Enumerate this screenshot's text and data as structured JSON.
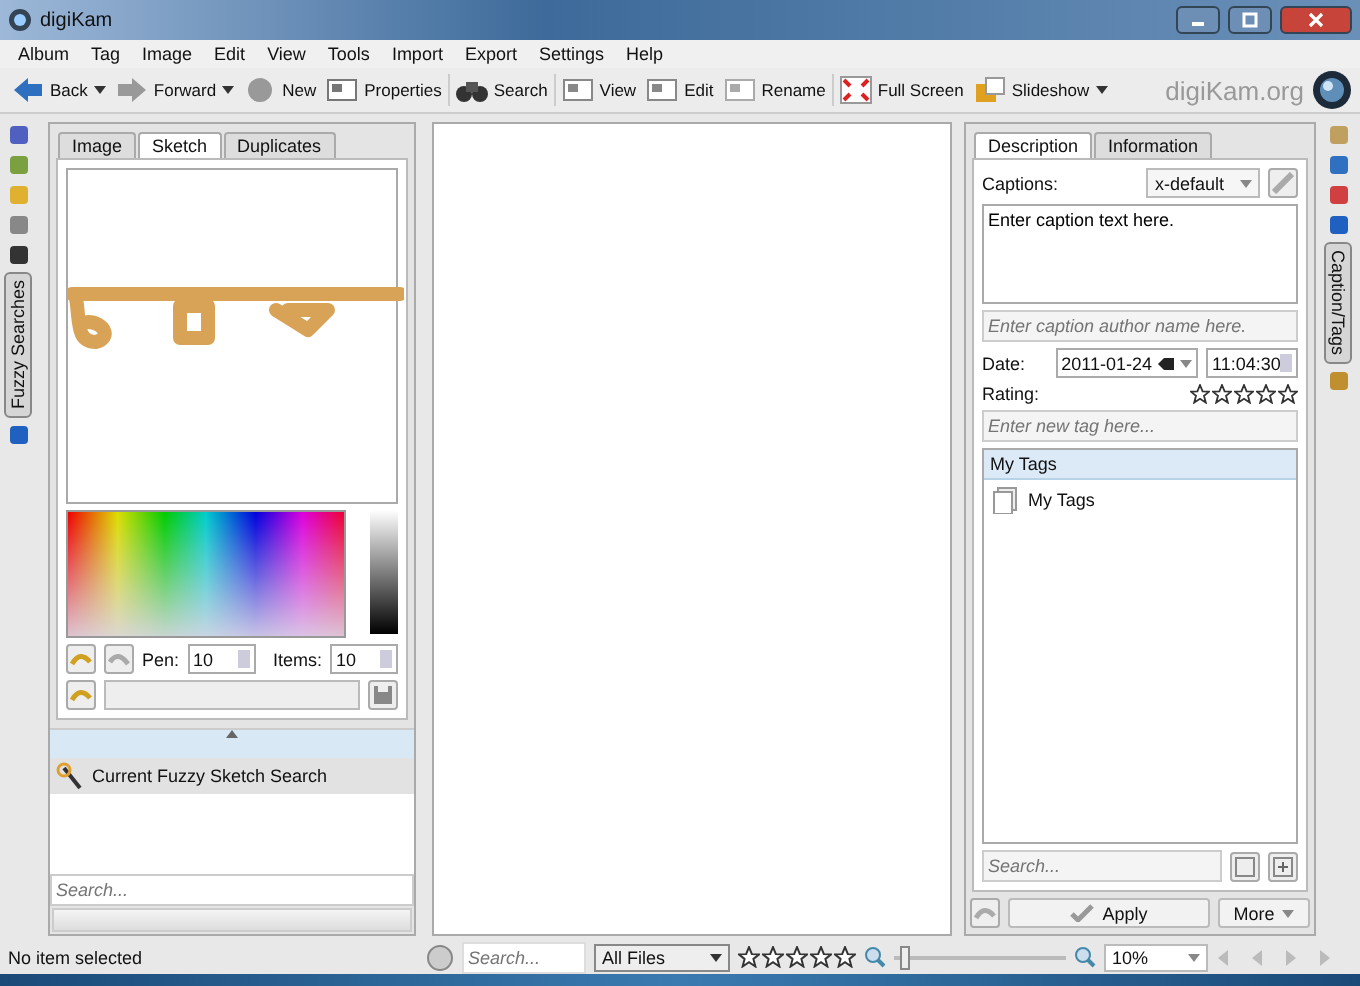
{
  "window": {
    "title": "digiKam"
  },
  "menu": [
    "Album",
    "Tag",
    "Image",
    "Edit",
    "View",
    "Tools",
    "Import",
    "Export",
    "Settings",
    "Help"
  ],
  "toolbar": [
    {
      "label": "Back",
      "kind": "back",
      "dropdown": true
    },
    {
      "label": "Forward",
      "kind": "forward",
      "dropdown": true
    },
    {
      "label": "New",
      "kind": "new",
      "dropdown": false
    },
    {
      "label": "Properties",
      "kind": "properties",
      "dropdown": false
    },
    {
      "label": "Search",
      "kind": "search",
      "dropdown": false
    },
    {
      "label": "View",
      "kind": "view",
      "dropdown": false
    },
    {
      "label": "Edit",
      "kind": "edit",
      "dropdown": false
    },
    {
      "label": "Rename",
      "kind": "rename",
      "dropdown": false
    },
    {
      "label": "Full Screen",
      "kind": "fullscreen",
      "dropdown": false
    },
    {
      "label": "Slideshow",
      "kind": "slideshow",
      "dropdown": true
    }
  ],
  "brand": "digiKam.org",
  "left_sidebar": [
    {
      "selected": false
    },
    {
      "selected": false
    },
    {
      "selected": false
    },
    {
      "selected": false
    },
    {
      "selected": false
    },
    {
      "label": "Fuzzy Searches",
      "selected": true
    },
    {
      "selected": false
    }
  ],
  "fuzzy_panel": {
    "tabs": [
      {
        "label": "Image",
        "selected": false
      },
      {
        "label": "Sketch",
        "selected": true
      },
      {
        "label": "Duplicates",
        "selected": false
      }
    ],
    "pen_label": "Pen:",
    "pen": "10",
    "items_label": "Items:",
    "items": "10",
    "saved_searches": {
      "items": [
        {
          "label": "Current Fuzzy Sketch Search",
          "selected": true
        }
      ]
    },
    "search": {
      "placeholder": "Search..."
    }
  },
  "right_panel": {
    "tabs": [
      {
        "label": "Description",
        "selected": true
      },
      {
        "label": "Information",
        "selected": false
      }
    ],
    "captions_label": "Captions:",
    "language": "x-default",
    "caption_text": "Enter caption text here.",
    "author": {
      "placeholder": "Enter caption author name here."
    },
    "date_label": "Date:",
    "date": "2011-01-24",
    "time": "11:04:30",
    "rating_label": "Rating:",
    "stars": 0,
    "new_tag": {
      "placeholder": "Enter new tag here..."
    },
    "tags": {
      "header": "My Tags",
      "children": [
        {
          "label": "My Tags"
        }
      ]
    },
    "search": {
      "placeholder": "Search..."
    },
    "buttons": [
      {
        "label": "Apply",
        "kind": "apply"
      },
      {
        "label": "More",
        "kind": "more"
      }
    ]
  },
  "right_sidebar": [
    {
      "selected": false
    },
    {
      "selected": false
    },
    {
      "selected": false
    },
    {
      "selected": false
    },
    {
      "label": "Caption/Tags",
      "selected": true
    },
    {
      "selected": false
    }
  ],
  "status_bar": {
    "message": "No item selected",
    "search": {
      "placeholder": "Search..."
    },
    "filter": "All Files",
    "stars": 0,
    "zoom": {
      "level": 0.03
    },
    "zoom_text": "10%"
  }
}
